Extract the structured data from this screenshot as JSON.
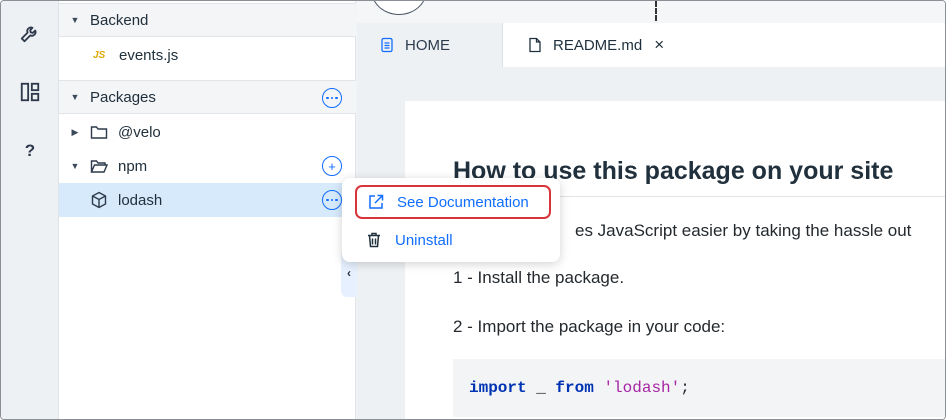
{
  "rail": {
    "help_label": "?"
  },
  "sidebar": {
    "backend_section": "Backend",
    "backend_file": "events.js",
    "js_badge": "JS",
    "packages_section": "Packages",
    "folder_velo": "@velo",
    "folder_npm": "npm",
    "package_lodash": "lodash"
  },
  "tabs": {
    "home_label": "HOME",
    "readme_label": "README.md",
    "close_glyph": "×"
  },
  "document": {
    "heading": "How to use this package on your site",
    "intro_partial": "es JavaScript easier by taking the hassle out",
    "step1": "1 - Install the package.",
    "step2": "2 - Import the package in your code:",
    "code": {
      "kw_import": "import",
      "underscore": " _ ",
      "kw_from": "from",
      "space": " ",
      "module": "'lodash'",
      "semicolon": ";"
    }
  },
  "context_menu": {
    "see_documentation": "See Documentation",
    "uninstall": "Uninstall"
  },
  "colors": {
    "accent": "#116dff",
    "selected_row": "#d6eafc",
    "highlight_border": "#d9343a"
  }
}
